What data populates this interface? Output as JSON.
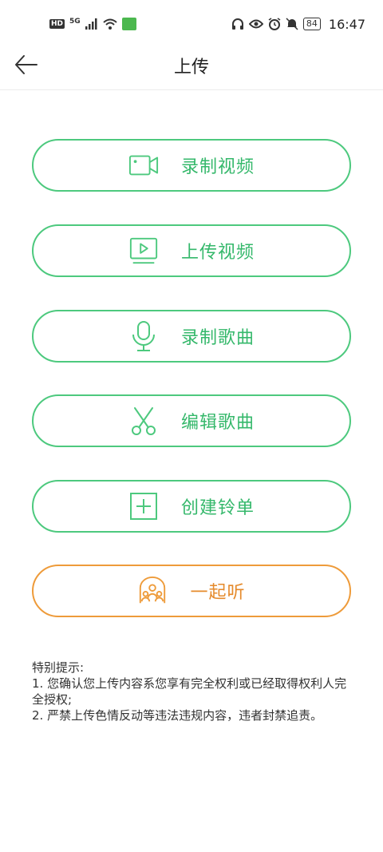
{
  "status_bar": {
    "hd": "HD",
    "network": "5G",
    "battery": "84",
    "time": "16:47"
  },
  "header": {
    "title": "上传"
  },
  "actions": [
    {
      "label": "录制视频",
      "icon": "video-camera-icon"
    },
    {
      "label": "上传视频",
      "icon": "play-screen-icon"
    },
    {
      "label": "录制歌曲",
      "icon": "microphone-icon"
    },
    {
      "label": "编辑歌曲",
      "icon": "scissors-icon"
    },
    {
      "label": "创建铃单",
      "icon": "add-box-icon"
    },
    {
      "label": "一起听",
      "icon": "listen-together-icon"
    }
  ],
  "notes": {
    "title": "特别提示:",
    "line1": "1. 您确认您上传内容系您享有完全权利或已经取得权利人完全授权;",
    "line2": "2. 严禁上传色情反动等违法违规内容，违者封禁追责。"
  },
  "colors": {
    "accent": "#4dc97e",
    "accent_text": "#35b86b",
    "orange": "#ee9b3a"
  }
}
